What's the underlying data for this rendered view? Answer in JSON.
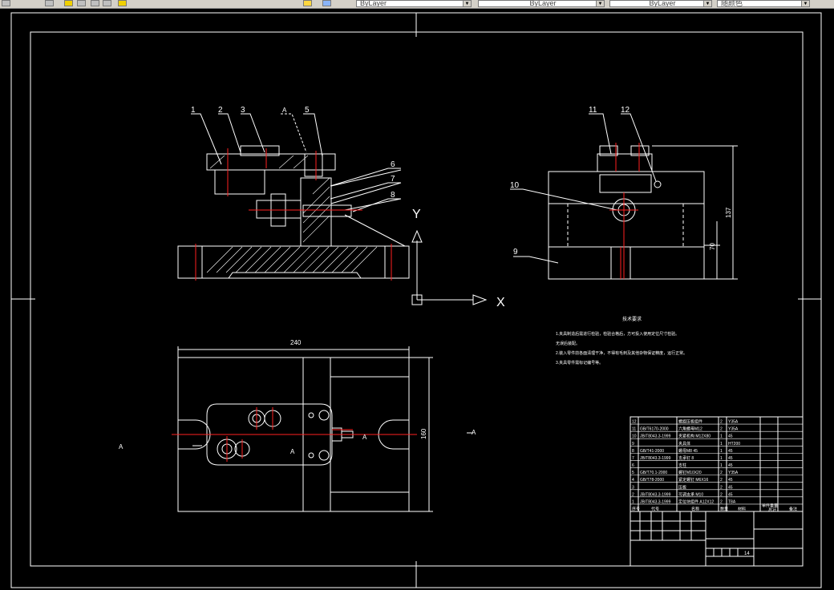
{
  "toolbar": {
    "layer_combo_1": "ByLayer",
    "layer_combo_2": "ByLayer",
    "layer_combo_3": "ByLayer",
    "layer_combo_4": "随颜色"
  },
  "drawing": {
    "balloons_front": [
      "1",
      "2",
      "3",
      "A",
      "5",
      "6",
      "7",
      "8"
    ],
    "balloons_side": [
      "11",
      "12",
      "10",
      "9"
    ],
    "dim_top": "240",
    "dim_right": "160",
    "dim_side_height": "137",
    "dim_side_small": "70",
    "section_label_left": "A",
    "section_label_right": "A",
    "section_label_mid_1": "A",
    "section_label_mid_2": "A",
    "ucs_y": "Y",
    "ucs_x": "X",
    "notes_title": "技术要求",
    "notes": [
      "1.夹具制造后需进行检验，检验合格后，方可投入使用定位尺寸检验。",
      "无误后装配。",
      "2.装入零件前各面清理干净，不得有毛刺及其他杂物保证精度，运行正常。",
      "3.夹具零件需标记编号等。"
    ],
    "sheet_no": "14"
  },
  "bom": {
    "rows": [
      {
        "no": "12",
        "code": "",
        "name": "螺旋压板组件",
        "qty": "2",
        "mat": "Y35A"
      },
      {
        "no": "11",
        "code": "GB/T6170-2000",
        "name": "六角螺母M12",
        "qty": "2",
        "mat": "Y35A"
      },
      {
        "no": "10",
        "code": "JB/T8043.3-1999",
        "name": "夹紧机构 M12X80",
        "qty": "1",
        "mat": "45"
      },
      {
        "no": "9",
        "code": "",
        "name": "夹具体",
        "qty": "1",
        "mat": "HT200"
      },
      {
        "no": "8",
        "code": "GB/T41-2000",
        "name": "螺母M8 45",
        "qty": "1",
        "mat": "45"
      },
      {
        "no": "7",
        "code": "JB/T8043.3-1999",
        "name": "支承钉 8",
        "qty": "1",
        "mat": "45"
      },
      {
        "no": "6",
        "code": "",
        "name": "支柱",
        "qty": "1",
        "mat": "45"
      },
      {
        "no": "5",
        "code": "GB/T70.1-2000",
        "name": "螺钉M10X20",
        "qty": "2",
        "mat": "Y35A"
      },
      {
        "no": "4",
        "code": "GB/T78-2000",
        "name": "紧定螺钉 M6X16",
        "qty": "2",
        "mat": "45"
      },
      {
        "no": "3",
        "code": "",
        "name": "压板",
        "qty": "2",
        "mat": "45"
      },
      {
        "no": "2",
        "code": "JB/T8043.3-1999",
        "name": "可调支承 M10",
        "qty": "2",
        "mat": "45"
      },
      {
        "no": "1",
        "code": "JB/T8043.3-1999",
        "name": "定位块组件 A12X12",
        "qty": "2",
        "mat": "T8A"
      }
    ],
    "header": {
      "no": "序号",
      "code": "代号",
      "name": "名称",
      "qty": "数量",
      "mat": "材料",
      "weight": "单件重量",
      "total": "总计",
      "note": "备注"
    }
  },
  "colors": {
    "line": "#ffffff",
    "center": "#ff2020",
    "background": "#000000",
    "toolbar": "#d4d0c8"
  },
  "icons": [
    "layer-icon",
    "save-icon",
    "print-icon",
    "layer-state-icon"
  ]
}
